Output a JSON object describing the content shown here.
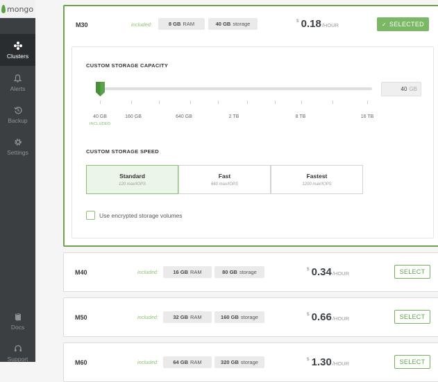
{
  "sidebar": {
    "logo_text": "mongo",
    "items": [
      {
        "label": "Clusters",
        "icon": "clusters-icon",
        "active": true
      },
      {
        "label": "Alerts",
        "icon": "bell-icon"
      },
      {
        "label": "Backup",
        "icon": "backup-icon"
      },
      {
        "label": "Settings",
        "icon": "gear-icon"
      }
    ],
    "bottom": [
      {
        "label": "Docs",
        "icon": "book-icon"
      },
      {
        "label": "Support",
        "icon": "headset-icon"
      }
    ]
  },
  "tiers": [
    {
      "name": "M30",
      "included_label": "included:",
      "ram_value": "8 GB",
      "ram_unit": "RAM",
      "storage_value": "40 GB",
      "storage_unit": "storage",
      "currency": "$",
      "price": "0.18",
      "per": "/HOUR",
      "button": "SELECTED",
      "selected": true
    },
    {
      "name": "M40",
      "included_label": "included:",
      "ram_value": "16 GB",
      "ram_unit": "RAM",
      "storage_value": "80 GB",
      "storage_unit": "storage",
      "currency": "$",
      "price": "0.34",
      "per": "/HOUR",
      "button": "SELECT"
    },
    {
      "name": "M50",
      "included_label": "included:",
      "ram_value": "32 GB",
      "ram_unit": "RAM",
      "storage_value": "160 GB",
      "storage_unit": "storage",
      "currency": "$",
      "price": "0.66",
      "per": "/HOUR",
      "button": "SELECT"
    },
    {
      "name": "M60",
      "included_label": "included:",
      "ram_value": "64 GB",
      "ram_unit": "RAM",
      "storage_value": "320 GB",
      "storage_unit": "storage",
      "currency": "$",
      "price": "1.30",
      "per": "/HOUR",
      "button": "SELECT"
    }
  ],
  "storage": {
    "title": "CUSTOM STORAGE CAPACITY",
    "ticks": [
      "40 GB",
      "160 GB",
      "640 GB",
      "2 TB",
      "8 TB",
      "16 TB"
    ],
    "included_note": "INCLUDED",
    "value": "40",
    "unit": "GB"
  },
  "speed": {
    "title": "CUSTOM STORAGE SPEED",
    "options": [
      {
        "name": "Standard",
        "iops": "120 max/IOPS",
        "active": true
      },
      {
        "name": "Fast",
        "iops": "660 max/IOPS"
      },
      {
        "name": "Fastest",
        "iops": "1200 max/IOPS"
      }
    ]
  },
  "encrypt_label": "Use encrypted storage volumes",
  "colors": {
    "accent": "#5aa24a",
    "selected_button": "#7ab866",
    "sidebar": "#3b3f42"
  }
}
